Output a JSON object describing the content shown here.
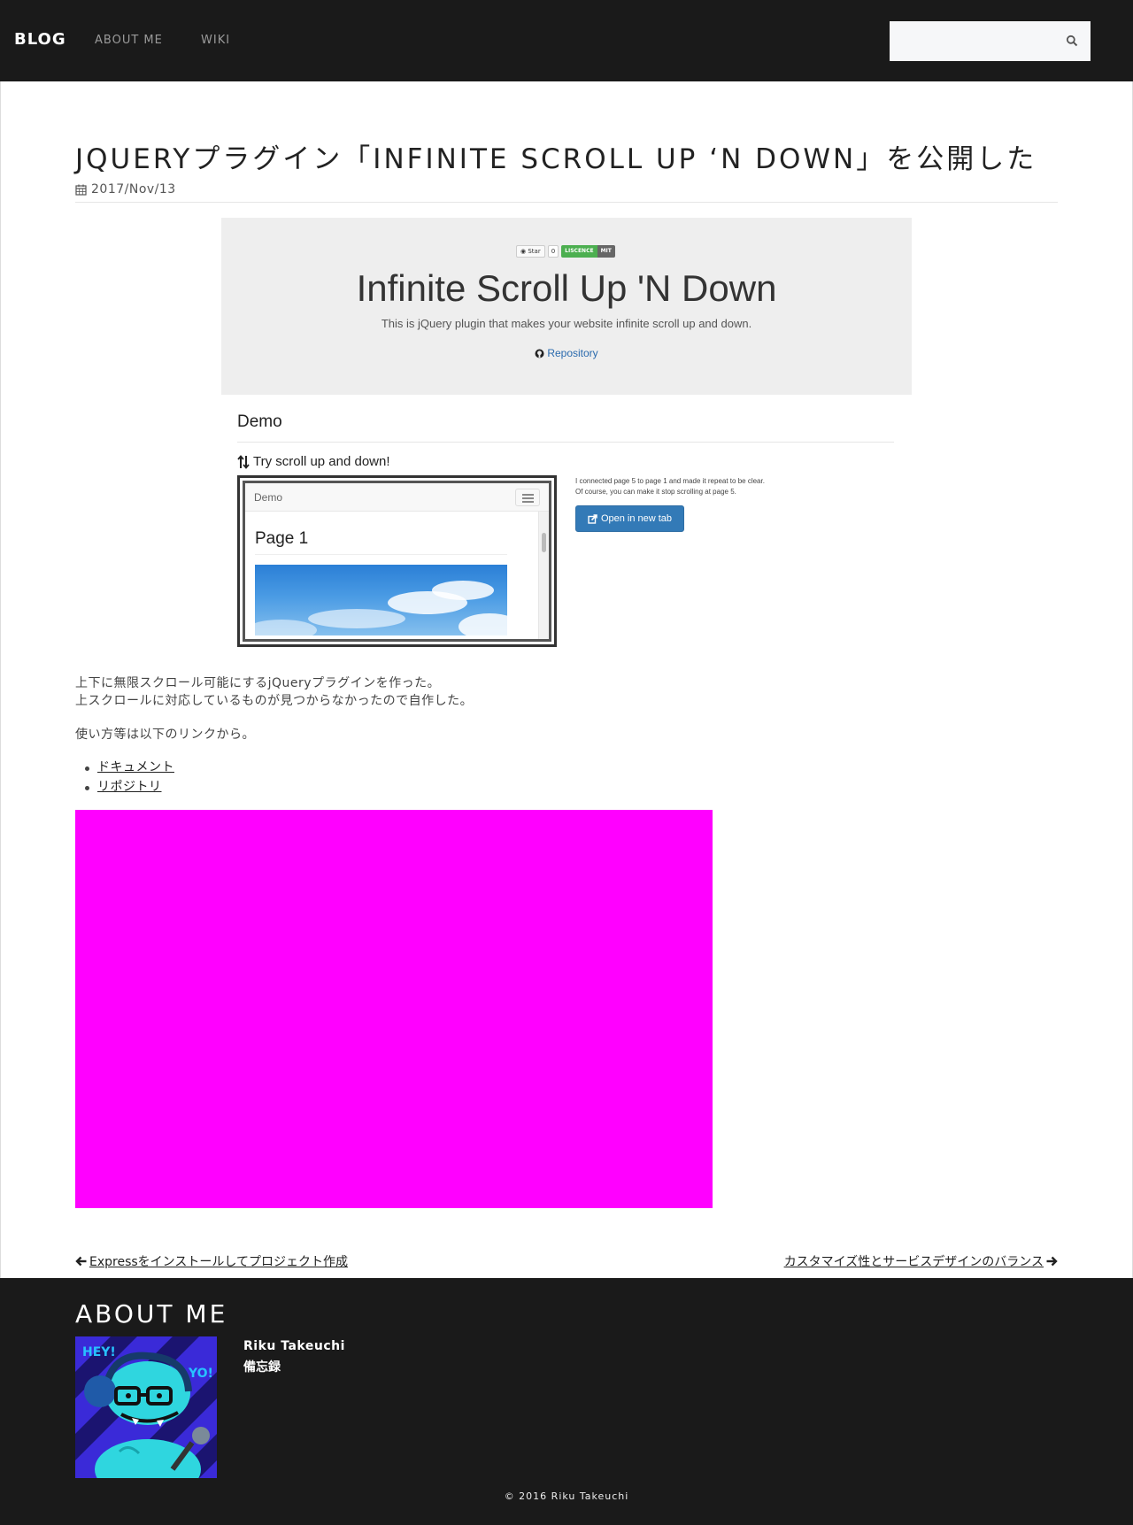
{
  "header": {
    "brand": "BLOG",
    "nav": [
      "ABOUT ME",
      "WIKI"
    ],
    "search_placeholder": ""
  },
  "post": {
    "title": "JQUERYプラグイン「INFINITE SCROLL UP ‘N DOWN」を公開した",
    "date": "2017/Nov/13",
    "screenshot": {
      "badge_star": "Star",
      "badge_count": "0",
      "badge_licence_label": "LISCENCE",
      "badge_licence_value": "MIT",
      "hero_title": "Infinite Scroll Up 'N Down",
      "hero_subtitle": "This is jQuery plugin that makes your website infinite scroll up and down.",
      "repo_link": "Repository",
      "demo_heading": "Demo",
      "try_heading": "Try scroll up and down!",
      "mini_brand": "Demo",
      "mini_page_title": "Page 1",
      "note_line1": "I connected page 5 to page 1 and made it repeat to be clear.",
      "note_line2": "Of course, you can make it stop scrolling at page 5.",
      "open_button": "Open in new tab"
    },
    "paragraphs": [
      "上下に無限スクロール可能にするjQueryプラグインを作った。",
      "上スクロールに対応しているものが見つからなかったので自作した。",
      "使い方等は以下のリンクから。"
    ],
    "links": [
      "ドキュメント",
      "リポジトリ"
    ],
    "embed_color": "#ff00ff",
    "prev_post": "Expressをインストールしてプロジェクト作成",
    "next_post": "カスタマイズ性とサービスデザインのバランス"
  },
  "footer": {
    "title": "ABOUT ME",
    "author_name": "Riku Takeuchi",
    "author_bio": "備忘録",
    "avatar_text_left": "HEY!",
    "avatar_text_right": "YO!",
    "copyright": "© 2016 Riku Takeuchi"
  },
  "colors": {
    "header_bg": "#1a1a1a",
    "accent_button": "#337ab7",
    "licence_green": "#4caf50"
  }
}
